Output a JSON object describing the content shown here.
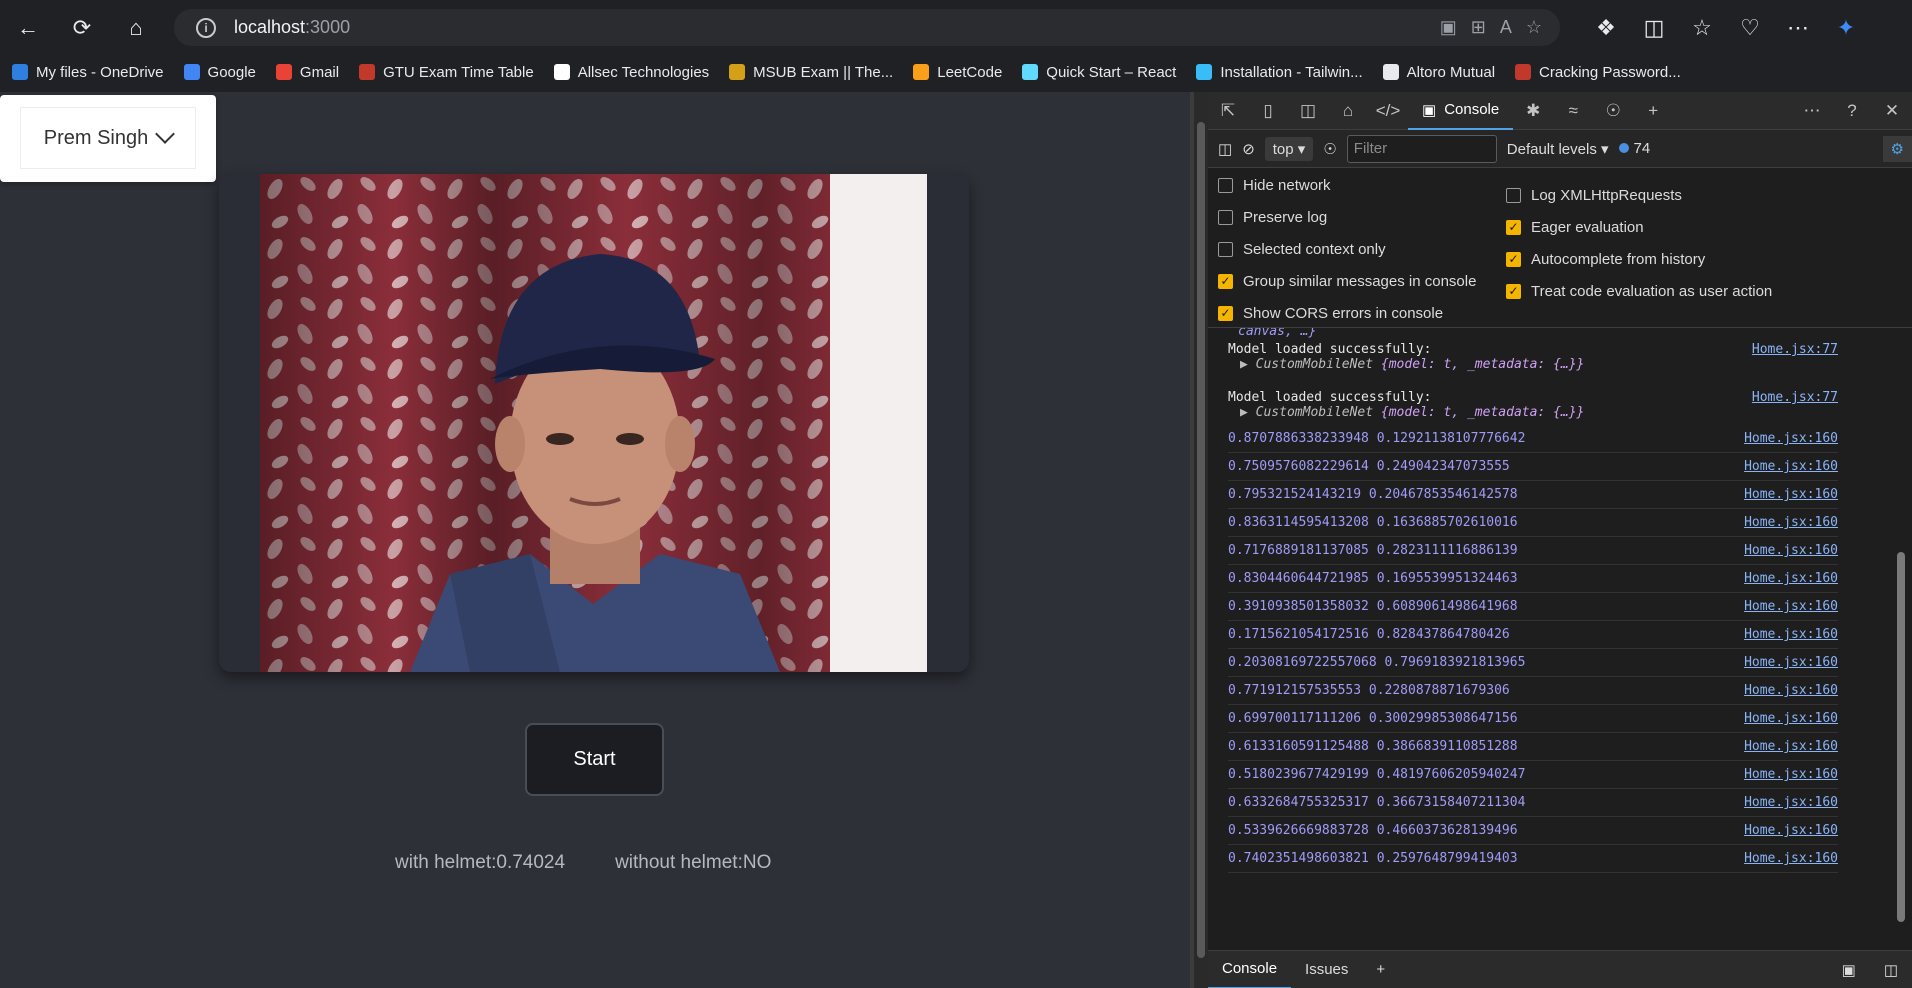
{
  "browser": {
    "address_host": "localhost",
    "address_port": ":3000"
  },
  "bookmarks": [
    {
      "label": "My files - OneDrive",
      "color": "#2f7fe0"
    },
    {
      "label": "Google",
      "color": "#4285f4"
    },
    {
      "label": "Gmail",
      "color": "#ea4335"
    },
    {
      "label": "GTU Exam Time Table",
      "color": "#c0392b"
    },
    {
      "label": "Allsec Technologies",
      "color": "#ffffff"
    },
    {
      "label": "MSUB Exam || The...",
      "color": "#d4a017"
    },
    {
      "label": "LeetCode",
      "color": "#f89f1b"
    },
    {
      "label": "Quick Start – React",
      "color": "#61dafb"
    },
    {
      "label": "Installation - Tailwin...",
      "color": "#38bdf8"
    },
    {
      "label": "Altoro Mutual",
      "color": "#e8eaed"
    },
    {
      "label": "Cracking Password...",
      "color": "#c0392b"
    }
  ],
  "page": {
    "user_name": "Prem Singh",
    "start_label": "Start",
    "result_with": "with helmet:0.74024",
    "result_without": "without helmet:NO"
  },
  "devtools": {
    "tab_console": "Console",
    "context": "top",
    "filter_placeholder": "Filter",
    "levels": "Default levels",
    "message_count": "74",
    "settings_left": [
      {
        "label": "Hide network",
        "checked": false
      },
      {
        "label": "Preserve log",
        "checked": false
      },
      {
        "label": "Selected context only",
        "checked": false
      },
      {
        "label": "Group similar messages in console",
        "checked": true
      },
      {
        "label": "Show CORS errors in console",
        "checked": true
      }
    ],
    "settings_right": [
      {
        "label": "Log XMLHttpRequests",
        "checked": false
      },
      {
        "label": "Eager evaluation",
        "checked": true
      },
      {
        "label": "Autocomplete from history",
        "checked": true
      },
      {
        "label": "Treat code evaluation as user action",
        "checked": true
      }
    ],
    "truncated_line": "canvas, …}",
    "model_messages": [
      {
        "text": "Model loaded successfully:",
        "obj_name": "CustomMobileNet",
        "obj_body": "{model: t, _metadata: {…}}",
        "link": "Home.jsx:77"
      },
      {
        "text": "Model loaded successfully:",
        "obj_name": "CustomMobileNet",
        "obj_body": "{model: t, _metadata: {…}}",
        "link": "Home.jsx:77"
      }
    ],
    "log_lines": [
      {
        "value": "0.8707886338233948 0.12921138107776642",
        "link": "Home.jsx:160"
      },
      {
        "value": "0.7509576082229614 0.249042347073555",
        "link": "Home.jsx:160"
      },
      {
        "value": "0.795321524143219 0.20467853546142578",
        "link": "Home.jsx:160"
      },
      {
        "value": "0.8363114595413208 0.1636885702610016",
        "link": "Home.jsx:160"
      },
      {
        "value": "0.7176889181137085 0.2823111116886139",
        "link": "Home.jsx:160"
      },
      {
        "value": "0.8304460644721985 0.1695539951324463",
        "link": "Home.jsx:160"
      },
      {
        "value": "0.3910938501358032 0.6089061498641968",
        "link": "Home.jsx:160"
      },
      {
        "value": "0.1715621054172516 0.828437864780426",
        "link": "Home.jsx:160"
      },
      {
        "value": "0.20308169722557068 0.7969183921813965",
        "link": "Home.jsx:160"
      },
      {
        "value": "0.771912157535553 0.2280878871679306",
        "link": "Home.jsx:160"
      },
      {
        "value": "0.699700117111206 0.30029985308647156",
        "link": "Home.jsx:160"
      },
      {
        "value": "0.6133160591125488 0.3866839110851288",
        "link": "Home.jsx:160"
      },
      {
        "value": "0.5180239677429199 0.48197606205940247",
        "link": "Home.jsx:160"
      },
      {
        "value": "0.6332684755325317 0.36673158407211304",
        "link": "Home.jsx:160"
      },
      {
        "value": "0.5339626669883728 0.4660373628139496",
        "link": "Home.jsx:160"
      },
      {
        "value": "0.7402351498603821 0.2597648799419403",
        "link": "Home.jsx:160"
      }
    ],
    "drawer_tabs": [
      "Console",
      "Issues"
    ]
  }
}
